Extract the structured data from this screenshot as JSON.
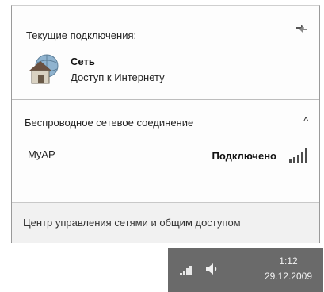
{
  "current": {
    "heading": "Текущие подключения:",
    "network_name": "Сеть",
    "network_status": "Доступ к Интернету",
    "refresh_icon": "refresh-icon",
    "network_icon": "house-globe-icon"
  },
  "wireless": {
    "heading": "Беспроводное сетевое соединение",
    "collapse_glyph": "^",
    "items": [
      {
        "ssid": "MyAP",
        "status": "Подключено",
        "signal_icon": "signal-strength-icon",
        "signal_level": "5/5"
      }
    ]
  },
  "footer": {
    "link": "Центр управления сетями и общим доступом"
  },
  "taskbar": {
    "time": "1:12",
    "date": "29.12.2009",
    "network_icon": "network-tray-icon",
    "volume_icon": "speaker-icon"
  },
  "colors": {
    "taskbar_bg": "#6a6a6a",
    "footer_bg": "#f1f1f1"
  }
}
